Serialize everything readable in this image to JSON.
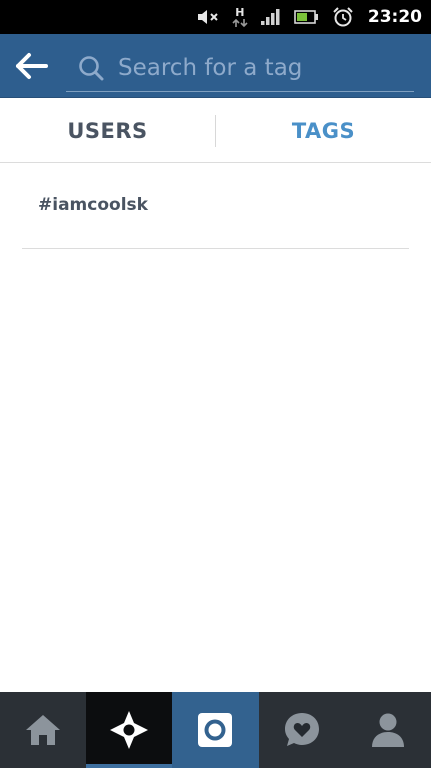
{
  "status_bar": {
    "time": "23:20",
    "network_label": "H",
    "icons": [
      "mute-icon",
      "network-h-icon",
      "signal-icon",
      "battery-icon",
      "alarm-icon"
    ]
  },
  "header": {
    "back_icon": "back-arrow-icon",
    "search": {
      "placeholder": "Search for a tag",
      "value": ""
    }
  },
  "tabs": [
    {
      "label": "USERS",
      "active": false
    },
    {
      "label": "TAGS",
      "active": true
    }
  ],
  "results": [
    {
      "label": "#iamcoolsk"
    }
  ],
  "bottom_nav": {
    "items": [
      {
        "name": "home",
        "icon": "home-icon",
        "active": false
      },
      {
        "name": "explore",
        "icon": "explore-icon",
        "active": true
      },
      {
        "name": "camera",
        "icon": "camera-icon",
        "active": false
      },
      {
        "name": "news",
        "icon": "heart-bubble-icon",
        "active": false
      },
      {
        "name": "profile",
        "icon": "profile-icon",
        "active": false
      }
    ]
  },
  "colors": {
    "header_bg": "#2e5e8e",
    "tab_active": "#4a90c8",
    "tab_inactive": "#4a5462",
    "nav_bg": "#252a30",
    "nav_camera_bg": "#33628f",
    "nav_explore_bg": "#0c0d0f"
  }
}
